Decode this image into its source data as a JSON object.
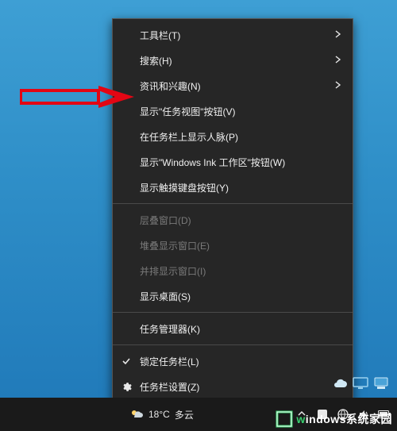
{
  "menu": {
    "groups": [
      [
        {
          "key": "toolbar",
          "label": "工具栏(T)",
          "submenu": true,
          "enabled": true
        },
        {
          "key": "search",
          "label": "搜索(H)",
          "submenu": true,
          "enabled": true
        },
        {
          "key": "news",
          "label": "资讯和兴趣(N)",
          "submenu": true,
          "enabled": true
        },
        {
          "key": "taskview",
          "label": "显示\"任务视图\"按钮(V)",
          "submenu": false,
          "enabled": true
        },
        {
          "key": "people",
          "label": "在任务栏上显示人脉(P)",
          "submenu": false,
          "enabled": true
        },
        {
          "key": "ink",
          "label": "显示\"Windows Ink 工作区\"按钮(W)",
          "submenu": false,
          "enabled": true
        },
        {
          "key": "touchkb",
          "label": "显示触摸键盘按钮(Y)",
          "submenu": false,
          "enabled": true
        }
      ],
      [
        {
          "key": "cascade",
          "label": "层叠窗口(D)",
          "submenu": false,
          "enabled": false
        },
        {
          "key": "stacked",
          "label": "堆叠显示窗口(E)",
          "submenu": false,
          "enabled": false
        },
        {
          "key": "sidebys",
          "label": "并排显示窗口(I)",
          "submenu": false,
          "enabled": false
        },
        {
          "key": "desktop",
          "label": "显示桌面(S)",
          "submenu": false,
          "enabled": true
        }
      ],
      [
        {
          "key": "taskmgr",
          "label": "任务管理器(K)",
          "submenu": false,
          "enabled": true
        }
      ],
      [
        {
          "key": "lock",
          "label": "锁定任务栏(L)",
          "submenu": false,
          "enabled": true,
          "checked": true
        },
        {
          "key": "settings",
          "label": "任务栏设置(Z)",
          "submenu": false,
          "enabled": true,
          "gear": true
        }
      ]
    ]
  },
  "taskbar": {
    "weather_temp": "18°C",
    "weather_text": "多云"
  },
  "watermark": {
    "text_prefix": "w",
    "text_rest": "indows系统家园"
  }
}
